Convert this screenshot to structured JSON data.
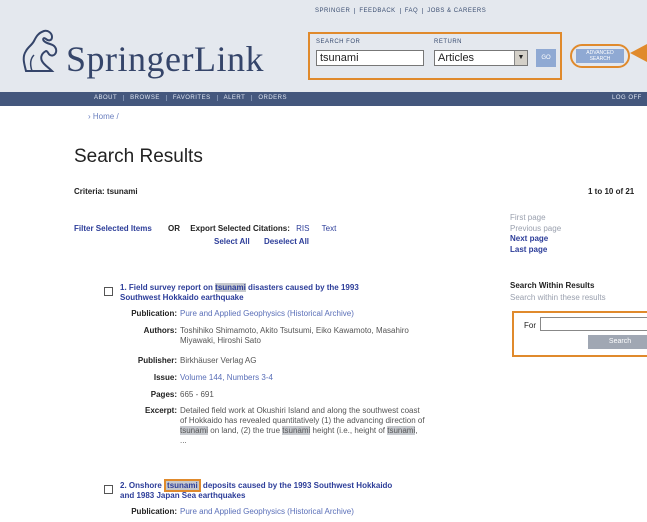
{
  "header": {
    "top_links": [
      "SPRINGER",
      "FEEDBACK",
      "FAQ",
      "JOBS & CAREERS"
    ],
    "logo_text": "SpringerLink",
    "search_for_label": "SEARCH FOR",
    "search_value": "tsunami",
    "return_label": "RETURN",
    "return_value": "Articles",
    "go_label": "GO",
    "advanced_label_1": "ADVANCED",
    "advanced_label_2": "SEARCH"
  },
  "nav": {
    "items": [
      "ABOUT",
      "BROWSE",
      "FAVORITES",
      "ALERT",
      "ORDERS"
    ],
    "logoff": "LOG OFF"
  },
  "breadcrumb": "› Home /",
  "page_title": "Search Results",
  "criteria": "Criteria: tsunami",
  "count": "1 to 10 of 21",
  "filter": {
    "filter_label": "Filter Selected Items",
    "or": "OR",
    "export_label": "Export Selected Citations:",
    "ris": "RIS",
    "text": "Text",
    "select_all": "Select All",
    "deselect_all": "Deselect All"
  },
  "pager": {
    "first": "First page",
    "previous": "Previous page",
    "next": "Next page",
    "last": "Last page"
  },
  "search_within": {
    "title": "Search Within Results",
    "subtitle": "Search within these results",
    "for_label": "For",
    "button": "Search"
  },
  "results": [
    {
      "number": "1.",
      "title_a": "Field survey report on ",
      "title_hl": "tsunami",
      "title_b": " disasters caused by the 1993",
      "title_line2": "Southwest Hokkaido earthquake",
      "publication_label": "Publication:",
      "publication": "Pure and Applied Geophysics (Historical Archive)",
      "authors_label": "Authors:",
      "authors_1": "Toshihiko Shimamoto, Akito Tsutsumi, Eiko Kawamoto, Masahiro",
      "authors_2": "Miyawaki, Hiroshi Sato",
      "publisher_label": "Publisher:",
      "publisher": "Birkhäuser Verlag AG",
      "issue_label": "Issue:",
      "issue": "Volume 144, Numbers 3-4",
      "pages_label": "Pages:",
      "pages": "665 - 691",
      "excerpt_label": "Excerpt:",
      "excerpt_1": "Detailed field work at Okushiri Island and along the southwest coast",
      "excerpt_2": "of Hokkaido has revealed quantitatively (1) the advancing direction of",
      "excerpt_3a": "tsunami",
      "excerpt_3b": " on land, (2) the true ",
      "excerpt_3c": "tsunami",
      "excerpt_3d": " height (i.e., height of ",
      "excerpt_3e": "tsunami",
      "excerpt_3f": ",",
      "excerpt_4": "..."
    },
    {
      "number": "2.",
      "title_a": "Onshore ",
      "title_hl": "tsunami",
      "title_b": " deposits caused by the 1993 Southwest Hokkaido",
      "title_line2": "and 1983 Japan Sea earthquakes",
      "publication_label": "Publication:",
      "publication": "Pure and Applied Geophysics (Historical Archive)"
    }
  ]
}
